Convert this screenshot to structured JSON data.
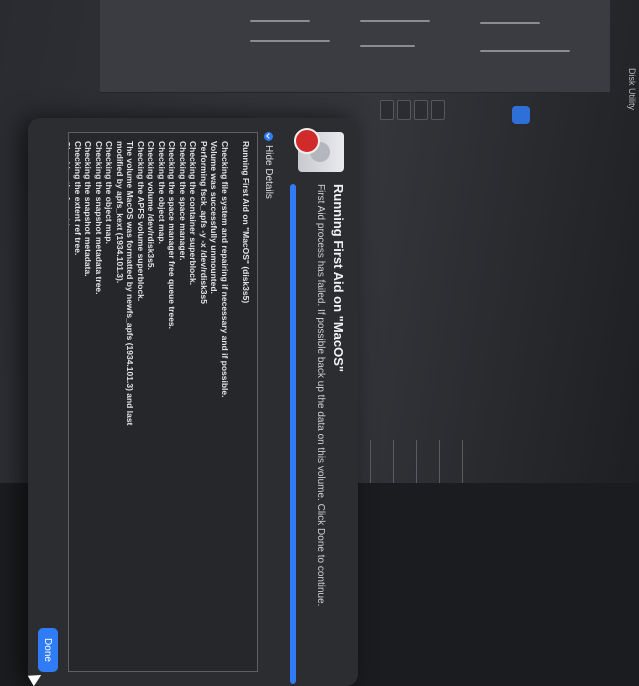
{
  "background": {
    "app_name": "Disk Utility"
  },
  "dialog": {
    "title": "Running First Aid on \"MacOS\"",
    "subtitle": "First Aid process has failed. If possible back up the data on this volume. Click Done to continue.",
    "progress": 1.0,
    "hide_details_label": "Hide Details",
    "log_lines": [
      "Running First Aid on \"MacOS\" (disk3s5)",
      "",
      "Checking file system and repairing if necessary and if possible.",
      "Volume was successfully unmounted.",
      "Performing fsck_apfs -y -x /dev/rdisk3s5",
      "Checking the container superblock.",
      "Checking the space manager.",
      "Checking the space manager free queue trees.",
      "Checking the object map.",
      "Checking volume /dev/rdisk3s5.",
      "Checking the APFS volume superblock.",
      "The volume MacOS was formatted by newfs_apfs (1934.101.3) and last",
      "modified by apfs_kext (1934.101.3).",
      "Checking the object map.",
      "Checking the snapshot metadata tree.",
      "Checking the snapshot metadata.",
      "Checking the extent ref tree.",
      "Checking the fsroot tree.",
      "Checking the file extent tree.",
      "Verifying allocated space.",
      "The volume /dev/rdisk3s5 could not be verified completely.",
      "File system check exit code is 8.",
      "Restoring the original state found as mounted.",
      "File system verify or repair failed. : (-69845)",
      "",
      "Operation failed…"
    ],
    "done_label": "Done"
  },
  "colors": {
    "accent": "#2f7cf6",
    "sheet_bg": "#2c2d31",
    "error_badge": "#d02a2a"
  }
}
